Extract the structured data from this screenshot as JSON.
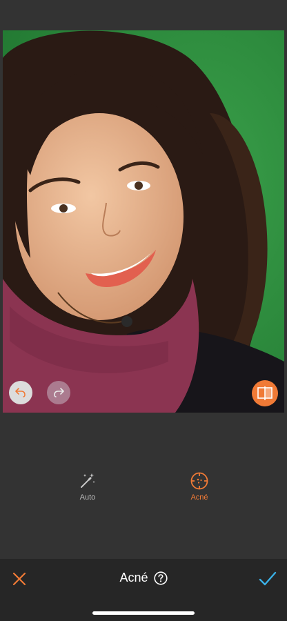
{
  "colors": {
    "accent": "#f07a36",
    "confirm": "#3ab0e6",
    "background": "#333333",
    "bottom_bar": "#262626"
  },
  "photo": {
    "icons": [
      "undo-icon",
      "redo-icon",
      "compare-icon"
    ]
  },
  "tools": [
    {
      "label": "Auto",
      "icon": "magic-wand-icon",
      "active": false
    },
    {
      "label": "Acné",
      "icon": "acne-target-icon",
      "active": true
    }
  ],
  "bottom_bar": {
    "title": "Acné",
    "cancel_icon": "close-icon",
    "help_icon": "help-icon",
    "confirm_icon": "checkmark-icon"
  }
}
